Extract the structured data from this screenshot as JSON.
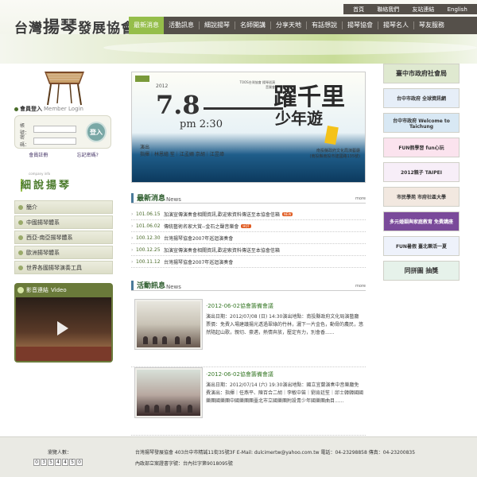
{
  "site": {
    "logo_main": "台灣",
    "logo_big": "揚琴",
    "logo_rest": "發展協會",
    "logo_seal": "印"
  },
  "util_links": [
    "首頁",
    "聯絡我們",
    "友站連結",
    "English"
  ],
  "nav": [
    "最新消息",
    "活動訊息",
    "細說揚琴",
    "名師開講",
    "分享天地",
    "有話想說",
    "揚琴協會",
    "揚琴名人",
    "琴友服務"
  ],
  "login": {
    "title": "會員登入",
    "title_en": "Member Login",
    "account_label": "帳號：",
    "password_label": "密碼：",
    "button": "登入",
    "register": "會員註冊",
    "forgot": "忘記密碼?"
  },
  "brand": {
    "sub": "company info",
    "title": "細說揚琴"
  },
  "side_menu": [
    "簡介",
    "中國揚琴體系",
    "西亞-南亞揚琴體系",
    "歐洲揚琴體系",
    "世界各國揚琴演奏工具"
  ],
  "video": {
    "title": "影音連結",
    "title_en": "Video"
  },
  "hero": {
    "year": "2012",
    "date": "7.8",
    "time": "pm 2:30",
    "title": "躍千里",
    "subtitle": "少年遊",
    "org": "TOOS台灣協會  揚琴巡演音樂會",
    "perf": "演出\n指揮｜林恩繪  笙｜江孟姍  京胡｜江昱璋",
    "note": "南投縣政府文化局演藝廳\n(南投縣南投市建國路135號)"
  },
  "news_section": {
    "title": "最新消息",
    "title_en": "News",
    "more": "more"
  },
  "news": [
    {
      "date": "101.06.15",
      "text": "加演宣傳演奏會相關資訊,歡迎索資料傳送至本協會信箱",
      "tag": "NEW"
    },
    {
      "date": "101.06.02",
      "text": "傳統藝術名家大賞--金石之聲音樂會",
      "tag": "HOT"
    },
    {
      "date": "100.12.30",
      "text": "台灣揚琴協會2007年巡迴演奏會",
      "tag": ""
    },
    {
      "date": "100.12.25",
      "text": "加演宣傳演奏會相關資訊,歡迎索資料傳送至本協會信箱",
      "tag": ""
    },
    {
      "date": "100.11.12",
      "text": "台灣揚琴協會2007年巡迴演奏會",
      "tag": ""
    }
  ],
  "activity_section": {
    "title": "活動訊息",
    "title_en": "News",
    "more": "more"
  },
  "activities": [
    {
      "title": "‧2012-06-02協會籌備會議",
      "body": "演出日期：2012/07/08 (日) 14:30演出地點：南投縣政府文化局演藝廳票價：免費入場建議揚光透過翠綠的竹林，灑下一片金色，動骨的農民，悠然隨起山歌，親切、豪邁，熱情奔放，壓定有力，別會香......"
    },
    {
      "title": "‧2012-06-02協會籌備會議",
      "body": "演出日期：2012/07/14 (六) 19:30演出地點：國立宜蘭演奏中音樂廳免費演出：指揮｜任燕平、陳百合二胡｜李敏中笛｜劉肯廷笙｜邱士韓韓國國樂團國樂團中國樂團團臺北市立國樂團附設青少年國樂團曲目......"
    }
  ],
  "ads": [
    "臺中市政府社會局",
    "台中市政府 全球資訊網",
    "台中市政府 Welcome to Taichung",
    "FUN假學習 fun心玩",
    "2012親子 TAIPEI",
    "市民學苑 市府社區大學",
    "多元婚姻與家庭教育 免費講座",
    "FUN暑假 臺北樂活一夏",
    "同拼圖 抽獎"
  ],
  "ad_colors": [
    "#dfe9d0",
    "#e6eef8",
    "#d8e8f4",
    "#fbe3ee",
    "#f7eef8",
    "#f2e8e0",
    "#7a4a9a",
    "#eef2fb",
    "#e6f2ea"
  ],
  "footer": {
    "visit_label": "瀏覽人數：",
    "counter": [
      "0",
      "3",
      "5",
      "4",
      "4",
      "5",
      "0"
    ],
    "addr": "台灣揚琴發展協會     403台中市精誠11街35號3F    E-Mail: dulcimertw@yahoo.com.tw    電話：04-23298858 傳真：04-23200835",
    "reg": "內政部立案證書字號：台內社字第9018095號"
  }
}
